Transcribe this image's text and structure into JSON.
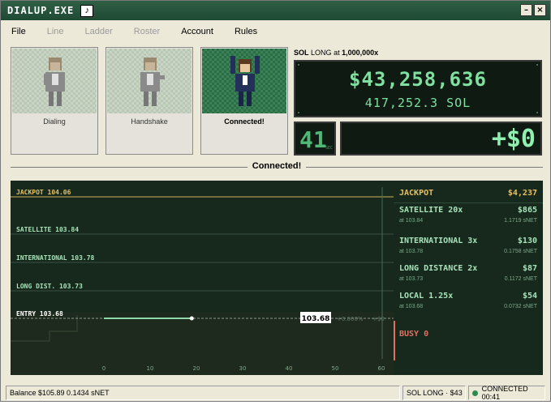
{
  "window": {
    "title": "DIALUP.EXE",
    "music_icon": "music-note-icon",
    "minimize_label": "–",
    "close_label": "×"
  },
  "menu": [
    {
      "label": "File",
      "enabled": true
    },
    {
      "label": "Line",
      "enabled": false
    },
    {
      "label": "Ladder",
      "enabled": false
    },
    {
      "label": "Roster",
      "enabled": false
    },
    {
      "label": "Account",
      "enabled": true
    },
    {
      "label": "Rules",
      "enabled": true
    }
  ],
  "stages": [
    {
      "label": "Dialing",
      "active": false
    },
    {
      "label": "Handshake",
      "active": false
    },
    {
      "label": "Connected!",
      "active": true
    }
  ],
  "position": {
    "symbol": "SOL",
    "side": "LONG",
    "at_word": "at",
    "leverage": "1,000,000x",
    "notional": "$43,258,636",
    "size": "417,252.3 SOL",
    "timer": "41",
    "timer_unit": "SEC",
    "pnl": "+$0"
  },
  "status_message": "Connected!",
  "chart": {
    "levels": [
      {
        "label": "JACKPOT",
        "price": "104.06"
      },
      {
        "label": "SATELLITE",
        "price": "103.84"
      },
      {
        "label": "INTERNATIONAL",
        "price": "103.78"
      },
      {
        "label": "LONG DIST.",
        "price": "103.73"
      },
      {
        "label": "ENTRY",
        "price": "103.68"
      }
    ],
    "current_price": "103.68",
    "change_pct": "+0.000%",
    "change_usd": "+$0",
    "x_ticks": [
      "0",
      "10",
      "20",
      "30",
      "40",
      "50",
      "60"
    ],
    "price_points": [
      {
        "t": 0,
        "p": 103.68
      },
      {
        "t": 5,
        "p": 103.68
      },
      {
        "t": 10,
        "p": 103.68
      },
      {
        "t": 15,
        "p": 103.68
      },
      {
        "t": 19,
        "p": 103.68
      }
    ],
    "colors": {
      "jackpot": "#e8c060",
      "entry": "#ffffff",
      "level": "#a7e3b9",
      "line": "#8fd8a8"
    }
  },
  "tiers": [
    {
      "name": "JACKPOT",
      "multiplier": "",
      "payout": "$4,237",
      "at": "",
      "snet": "",
      "jackpot": true
    },
    {
      "name": "SATELLITE",
      "multiplier": "20x",
      "payout": "$865",
      "at": "at 103.84",
      "snet": "1.1719 sNET",
      "jackpot": false
    },
    {
      "name": "INTERNATIONAL",
      "multiplier": "3x",
      "payout": "$130",
      "at": "at 103.78",
      "snet": "0.1758 sNET",
      "jackpot": false
    },
    {
      "name": "LONG DISTANCE",
      "multiplier": "2x",
      "payout": "$87",
      "at": "at 103.73",
      "snet": "0.1172 sNET",
      "jackpot": false
    },
    {
      "name": "LOCAL",
      "multiplier": "1.25x",
      "payout": "$54",
      "at": "at 103.68",
      "snet": "0.0732 sNET",
      "jackpot": false
    }
  ],
  "busy": {
    "label": "BUSY",
    "count": "0"
  },
  "statusbar": {
    "balance": "Balance $105.89 0.1434 sNET",
    "position": "SOL LONG · $43",
    "connection": "CONNECTED 00:41"
  }
}
